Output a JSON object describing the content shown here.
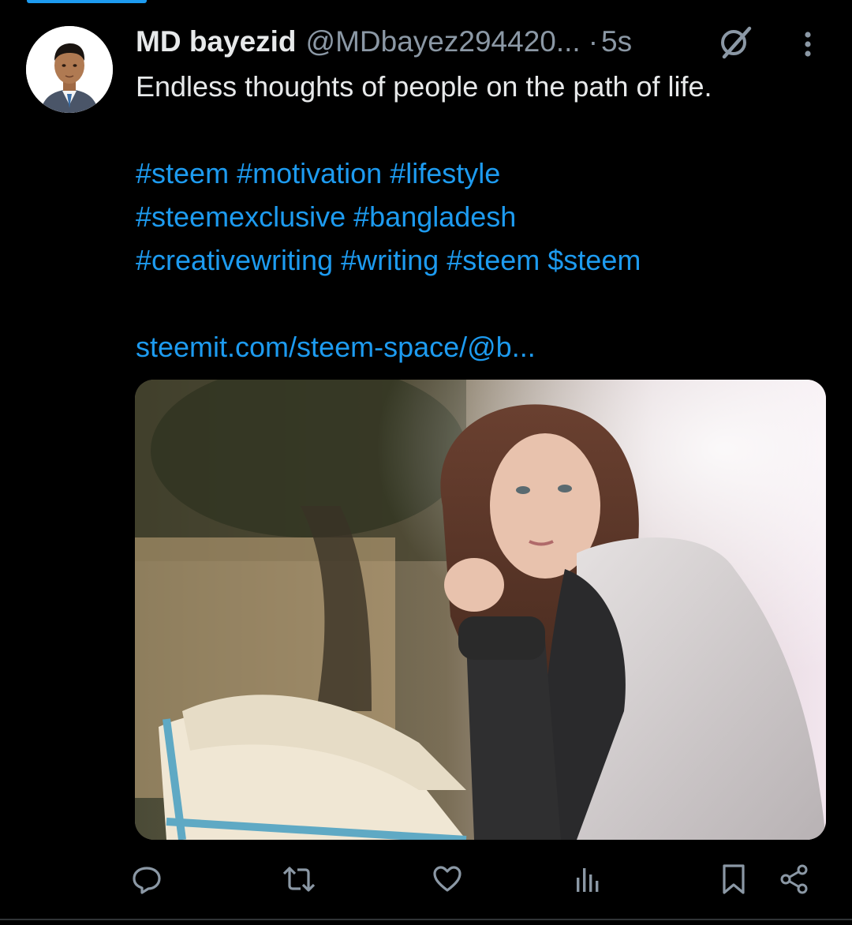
{
  "tweet": {
    "author": {
      "display_name": "MD bayezid",
      "handle": "@MDbayez294420...",
      "avatar_icon": "profile-photo"
    },
    "separator": "·",
    "timestamp": "5s",
    "text": {
      "intro": "Endless thoughts of people on the path of life.",
      "hashtag_lines": [
        [
          "#steem",
          "#motivation",
          "#lifestyle"
        ],
        [
          "#steemexclusive",
          "#bangladesh"
        ],
        [
          "#creativewriting",
          "#writing",
          "#steem",
          "$steem"
        ]
      ],
      "link": "steemit.com/steem-space/@b..."
    },
    "media": {
      "type": "photo",
      "description_icon": "image-woman-reading-book"
    }
  },
  "header_icons": {
    "grok": "grok-icon",
    "more": "more-vertical-icon"
  },
  "actions": [
    {
      "name": "reply",
      "icon": "reply-icon"
    },
    {
      "name": "repost",
      "icon": "repost-icon"
    },
    {
      "name": "like",
      "icon": "like-icon"
    },
    {
      "name": "views",
      "icon": "views-icon"
    },
    {
      "name": "bookmark",
      "icon": "bookmark-icon"
    },
    {
      "name": "share",
      "icon": "share-icon"
    }
  ],
  "colors": {
    "background": "#000000",
    "text_primary": "#e7e9ea",
    "text_secondary": "#8b98a5",
    "accent": "#1d9bf0"
  }
}
